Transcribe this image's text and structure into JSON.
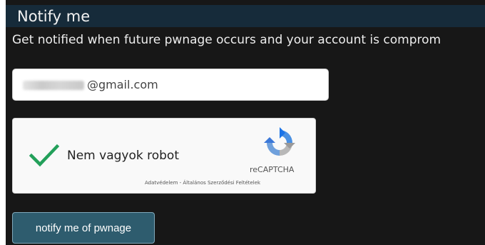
{
  "header": {
    "title": "Notify me"
  },
  "intro": {
    "text": "Get notified when future pwnage occurs and your account is comprom"
  },
  "email_field": {
    "visible_value": "@gmail.com"
  },
  "captcha": {
    "label": "Nem vagyok robot",
    "checked": true,
    "brand": "reCAPTCHA",
    "links": "Adatvédelem - Általános Szerződési Feltételek",
    "icon": "recaptcha-logo-icon"
  },
  "submit": {
    "label": "notify me of pwnage"
  },
  "colors": {
    "panel_bg": "#171717",
    "title_bar": "#162b3a",
    "button_bg": "#2e5c6e",
    "checkmark": "#23a05a"
  }
}
